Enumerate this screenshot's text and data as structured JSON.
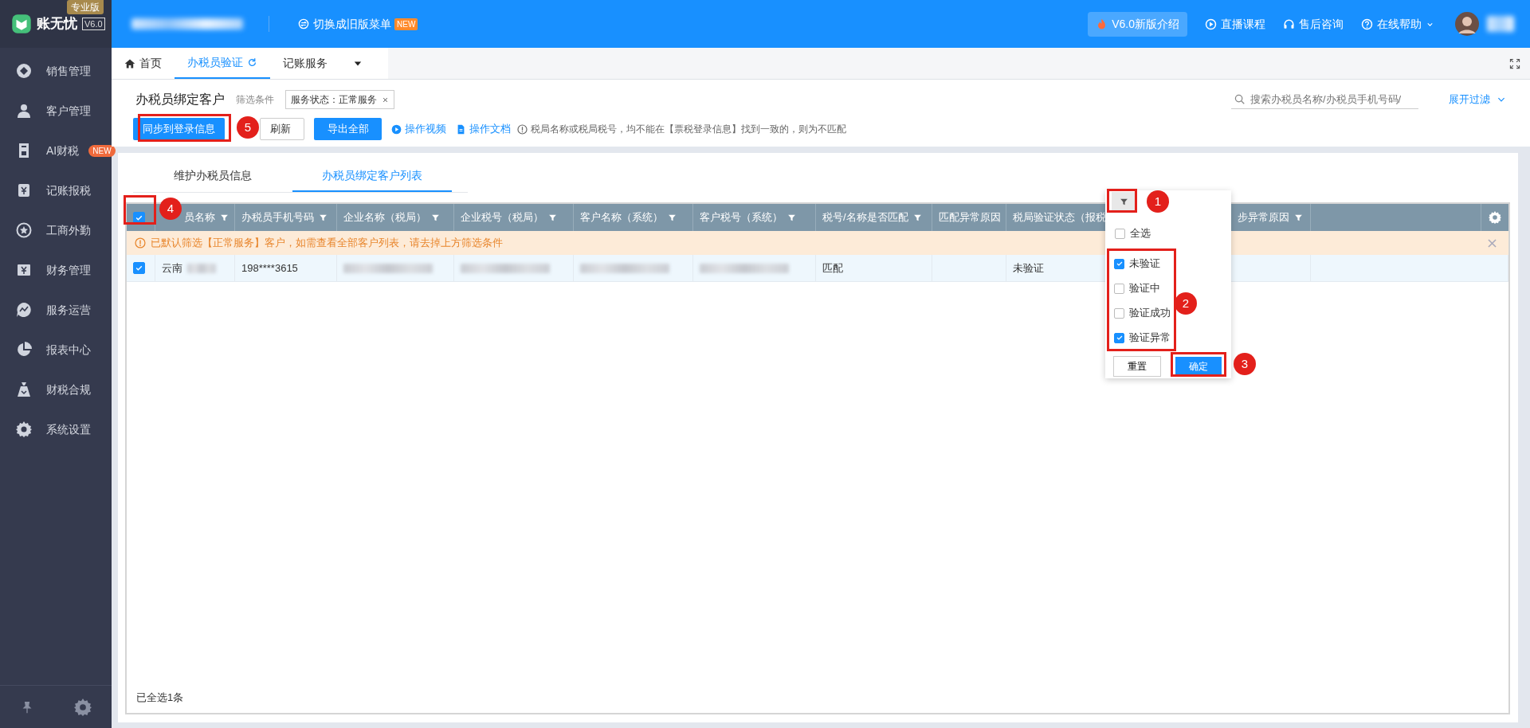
{
  "app": {
    "logo_text": "账无忧",
    "version": "V6.0",
    "edition": "专业版"
  },
  "top_bar": {
    "company_blurred": true,
    "switch_menu": "切换成旧版菜单",
    "switch_badge": "NEW",
    "links": [
      {
        "kind": "promo",
        "label": "V6.0新版介绍"
      },
      {
        "kind": "play",
        "label": "直播课程"
      },
      {
        "kind": "headset",
        "label": "售后咨询"
      },
      {
        "kind": "help",
        "label": "在线帮助"
      }
    ],
    "user_blurred": true
  },
  "sidebar": {
    "items": [
      {
        "kind": "diamond",
        "label": "销售管理"
      },
      {
        "kind": "person",
        "label": "客户管理"
      },
      {
        "kind": "doc",
        "label": "AI财税",
        "badge": "NEW"
      },
      {
        "kind": "ledger",
        "label": "记账报税"
      },
      {
        "kind": "star",
        "label": "工商外勤"
      },
      {
        "kind": "wallet",
        "label": "财务管理"
      },
      {
        "kind": "chart",
        "label": "服务运营"
      },
      {
        "kind": "pie",
        "label": "报表中心"
      },
      {
        "kind": "bag",
        "label": "财税合规"
      },
      {
        "kind": "gear",
        "label": "系统设置"
      }
    ]
  },
  "page_tabs": [
    {
      "kind": "home",
      "label": "首页",
      "selected": false
    },
    {
      "kind": "refresh",
      "label": "办税员验证",
      "selected": true
    },
    {
      "kind": "plain",
      "label": "记账服务",
      "selected": false
    }
  ],
  "header": {
    "title": "办税员绑定客户",
    "filter_label": "筛选条件",
    "filter_tag": "服务状态：正常服务",
    "search_placeholder": "搜索办税员名称/办税员手机号码/",
    "expand_filter": "展开过滤"
  },
  "toolbar": {
    "buttons": [
      {
        "kind": "primary",
        "label": "同步到登录信息"
      },
      {
        "kind": "outline",
        "label": "刷新"
      },
      {
        "kind": "primary",
        "label": "导出全部"
      }
    ],
    "links": [
      {
        "kind": "video",
        "label": "操作视频"
      },
      {
        "kind": "doc",
        "label": "操作文档"
      }
    ],
    "note": "税局名称或税局税号，均不能在【票税登录信息】找到一致的，则为不匹配"
  },
  "sub_tabs": [
    {
      "label": "维护办税员信息",
      "selected": false
    },
    {
      "label": "办税员绑定客户列表",
      "selected": true
    }
  ],
  "table": {
    "select_all_checked": true,
    "columns": [
      {
        "label": "员名称",
        "filter": true
      },
      {
        "label": "办税员手机号码",
        "filter": true
      },
      {
        "label": "企业名称（税局）",
        "filter": true
      },
      {
        "label": "企业税号（税局）",
        "filter": true
      },
      {
        "label": "客户名称（系统）",
        "filter": true
      },
      {
        "label": "客户税号（系统）",
        "filter": true
      },
      {
        "label": "税号/名称是否匹配",
        "filter": true
      },
      {
        "label": "匹配异常原因"
      },
      {
        "label": "税局验证状态（报税"
      },
      {
        "label": "步异常原因",
        "filter": true
      }
    ],
    "notice": "已默认筛选【正常服务】客户，如需查看全部客户列表，请去掉上方筛选条件",
    "rows": [
      {
        "checked": true,
        "cells": [
          {
            "text": "云南",
            "blurred": true
          },
          {
            "text": "198****3615",
            "blurred": false
          },
          {
            "blurred": true
          },
          {
            "blurred": true
          },
          {
            "blurred": true
          },
          {
            "blurred": true
          },
          {
            "text": "匹配",
            "blurred": false
          },
          null,
          {
            "text": "未验证",
            "blurred": false
          },
          null
        ]
      }
    ],
    "footer": "已全选1条"
  },
  "filter_dropdown": {
    "options": [
      {
        "label": "全选",
        "checked": false
      },
      {
        "label": "未验证",
        "checked": true
      },
      {
        "label": "验证中",
        "checked": false
      },
      {
        "label": "验证成功",
        "checked": false
      },
      {
        "label": "验证异常",
        "checked": true
      }
    ],
    "reset": "重置",
    "confirm": "确定"
  },
  "annotations": [
    {
      "number": "1"
    },
    {
      "number": "2"
    },
    {
      "number": "3"
    },
    {
      "number": "4"
    },
    {
      "number": "5"
    }
  ]
}
